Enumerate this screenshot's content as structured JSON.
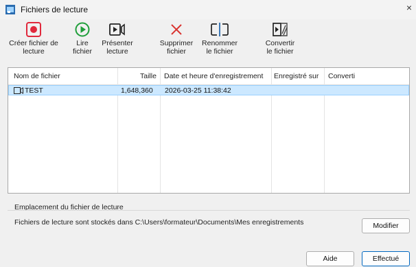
{
  "window": {
    "title": "Fichiers de lecture",
    "close_glyph": "×"
  },
  "toolbar": [
    {
      "line1": "Créer fichier de",
      "line2": "lecture",
      "icon": "record-icon"
    },
    {
      "line1": "Lire",
      "line2": "fichier",
      "icon": "play-icon"
    },
    {
      "line1": "Présenter",
      "line2": "lecture",
      "icon": "present-icon"
    },
    {
      "line1": "Supprimer",
      "line2": "fichier",
      "icon": "delete-icon"
    },
    {
      "line1": "Renommer",
      "line2": "le fichier",
      "icon": "rename-icon"
    },
    {
      "line1": "Convertir",
      "line2": "le fichier",
      "icon": "convert-icon"
    }
  ],
  "table": {
    "headers": [
      "Nom de fichier",
      "Taille",
      "Date et heure d'enregistrement",
      "Enregistré sur",
      "Converti"
    ],
    "rows": [
      {
        "name": "TEST",
        "size": "1,648,360",
        "date": "2026-03-25 11:38:42",
        "saved_on": "",
        "converted": "",
        "selected": true
      }
    ]
  },
  "location": {
    "label": "Emplacement du fichier de lecture",
    "text": "Fichiers de lecture sont stockés dans C:\\Users\\formateur\\Documents\\Mes enregistrements",
    "modify_label": "Modifier"
  },
  "footer": {
    "help_label": "Aide",
    "done_label": "Effectué"
  },
  "colors": {
    "record": "#e0283c",
    "play": "#1f9e3a",
    "delete": "#d9332f",
    "selection": "#cce8ff",
    "accent_border": "#0067c0"
  }
}
